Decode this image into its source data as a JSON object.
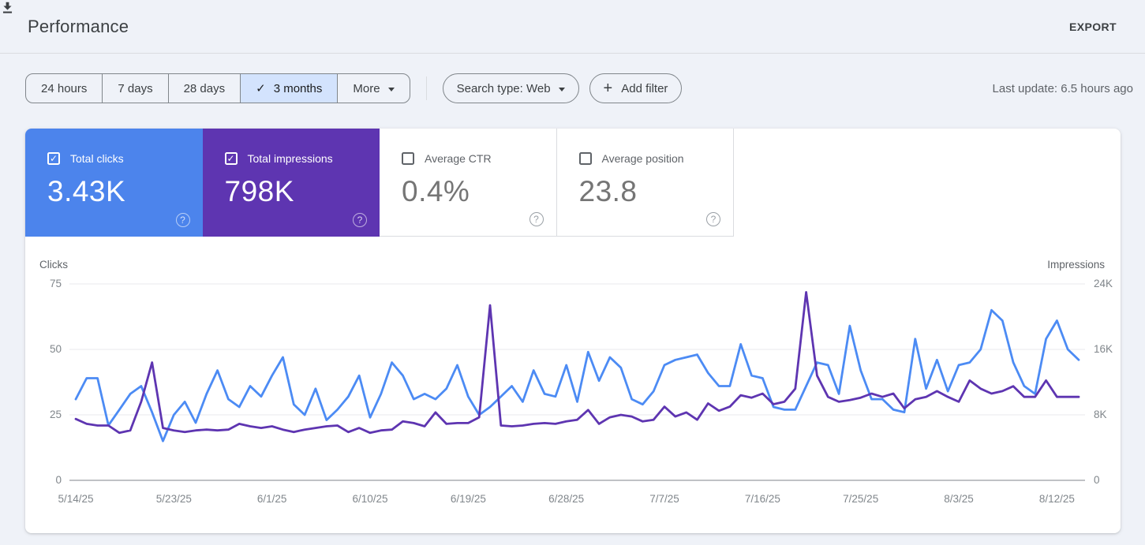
{
  "page": {
    "title": "Performance",
    "export_label": "EXPORT",
    "last_update": "Last update: 6.5 hours ago"
  },
  "filters": {
    "ranges": [
      "24 hours",
      "7 days",
      "28 days",
      "3 months"
    ],
    "selected_range": "3 months",
    "selected_check": "✓",
    "more_label": "More",
    "search_type_label": "Search type: Web",
    "add_filter_plus": "+",
    "add_filter_label": "Add filter"
  },
  "metrics": {
    "tiles": [
      {
        "label": "Total clicks",
        "value": "3.43K",
        "checked": true,
        "color": "#4c84ec",
        "help": "?"
      },
      {
        "label": "Total impressions",
        "value": "798K",
        "checked": true,
        "color": "#5e35b1",
        "help": "?"
      },
      {
        "label": "Average CTR",
        "value": "0.4%",
        "checked": false,
        "color": "#ffffff",
        "help": "?"
      },
      {
        "label": "Average position",
        "value": "23.8",
        "checked": false,
        "color": "#ffffff",
        "help": "?"
      }
    ]
  },
  "chart_data": {
    "type": "line",
    "grid": true,
    "left_axis": {
      "label": "Clicks",
      "ticks": [
        0,
        25,
        50,
        75
      ],
      "max": 75
    },
    "right_axis": {
      "label": "Impressions",
      "ticks": [
        {
          "label": "0",
          "value": 0
        },
        {
          "label": "8K",
          "value": 8000
        },
        {
          "label": "16K",
          "value": 16000
        },
        {
          "label": "24K",
          "value": 24000
        }
      ],
      "max": 24000
    },
    "x_tick_labels": [
      "5/14/25",
      "5/23/25",
      "6/1/25",
      "6/10/25",
      "6/19/25",
      "6/28/25",
      "7/7/25",
      "7/16/25",
      "7/25/25",
      "8/3/25",
      "8/12/25"
    ],
    "x_tick_indices": [
      0,
      9,
      18,
      27,
      36,
      45,
      54,
      63,
      72,
      81,
      90
    ],
    "series": [
      {
        "name": "Total clicks",
        "axis": "left",
        "color": "#4c8bf4",
        "values": [
          31,
          39,
          39,
          21,
          27,
          33,
          36,
          26,
          15,
          25,
          30,
          22,
          33,
          42,
          31,
          28,
          36,
          32,
          40,
          47,
          29,
          25,
          35,
          23,
          27,
          32,
          40,
          24,
          33,
          45,
          40,
          31,
          33,
          31,
          35,
          44,
          32,
          25,
          28,
          32,
          36,
          30,
          42,
          33,
          32,
          44,
          30,
          49,
          38,
          47,
          43,
          31,
          29,
          34,
          44,
          46,
          47,
          48,
          41,
          36,
          36,
          52,
          40,
          39,
          28,
          27,
          27,
          36,
          45,
          44,
          33,
          59,
          42,
          31,
          31,
          27,
          26,
          54,
          35,
          46,
          34,
          44,
          45,
          50,
          65,
          61,
          45,
          36,
          33,
          54,
          61,
          50,
          46
        ]
      },
      {
        "name": "Total impressions",
        "axis": "right",
        "color": "#5e35b1",
        "values": [
          7500,
          6900,
          6700,
          6700,
          5800,
          6100,
          9600,
          14400,
          6400,
          6100,
          5900,
          6100,
          6200,
          6100,
          6200,
          6900,
          6600,
          6400,
          6600,
          6200,
          5900,
          6200,
          6400,
          6600,
          6700,
          5900,
          6400,
          5800,
          6100,
          6200,
          7200,
          7000,
          6600,
          8300,
          6900,
          7000,
          7000,
          7700,
          21400,
          6700,
          6600,
          6700,
          6900,
          7000,
          6900,
          7200,
          7400,
          8600,
          6900,
          7700,
          8000,
          7800,
          7200,
          7400,
          9000,
          7800,
          8300,
          7400,
          9400,
          8500,
          9000,
          10400,
          10100,
          10600,
          9300,
          9600,
          11200,
          23000,
          12800,
          10200,
          9600,
          9800,
          10100,
          10600,
          10200,
          10600,
          8800,
          9900,
          10200,
          10900,
          10200,
          9600,
          12200,
          11200,
          10600,
          10900,
          11500,
          10200,
          10200,
          12200,
          10200,
          10200,
          10200
        ]
      }
    ]
  }
}
